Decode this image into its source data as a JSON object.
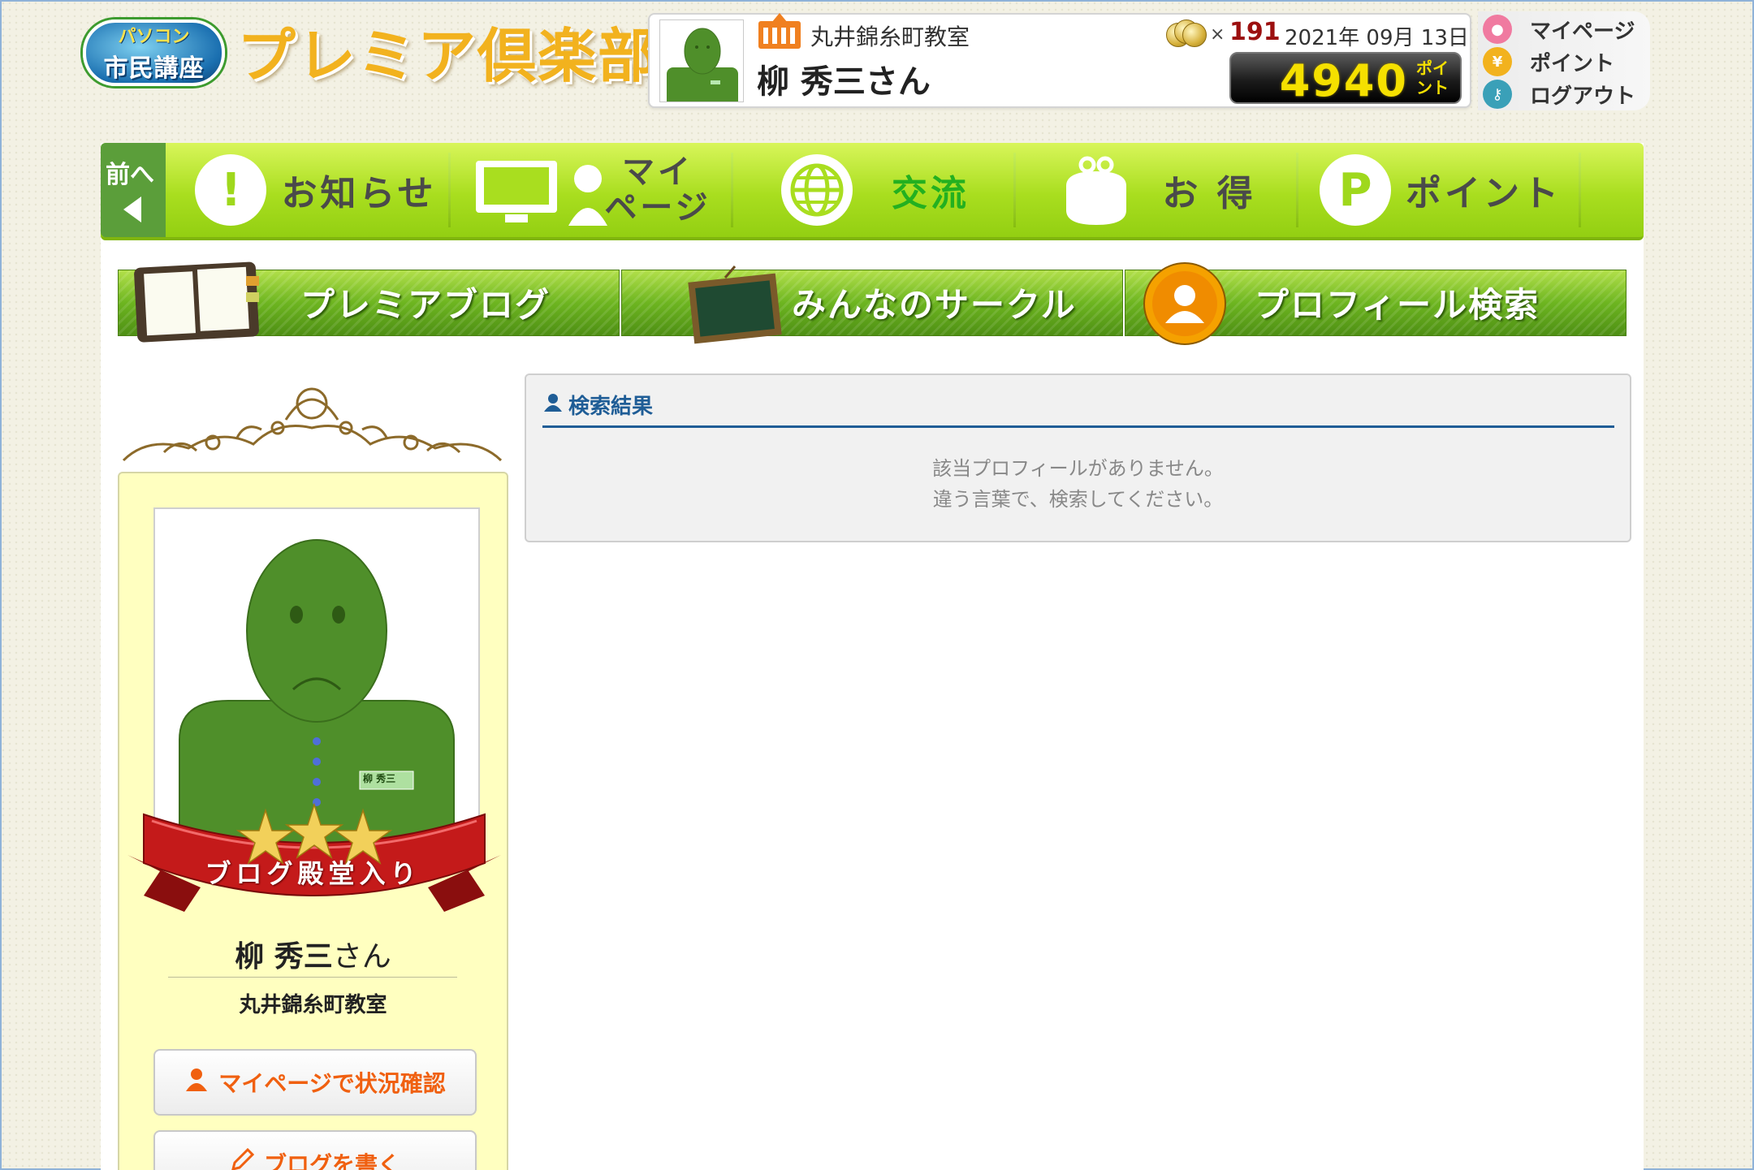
{
  "header": {
    "logo_line1": "パソコン",
    "logo_line2": "市民講座",
    "site_title": "プレミア倶楽部"
  },
  "user": {
    "school": "丸井錦糸町教室",
    "name": "柳 秀三さん",
    "coin_times": "×",
    "coin_count": "191",
    "date": "2021年 09月 13日",
    "points": "4940",
    "points_unit": "ポイント"
  },
  "quicklinks": [
    {
      "label": "マイページ",
      "icon": "person-icon",
      "color": "#f07aa0"
    },
    {
      "label": "ポイント",
      "icon": "coin-icon",
      "color": "#f2b21e"
    },
    {
      "label": "ログアウト",
      "icon": "key-icon",
      "color": "#3aa0b8"
    }
  ],
  "topnav": {
    "back_label": "前へ",
    "items": [
      {
        "label": "お知らせ",
        "icon": "exclamation-icon"
      },
      {
        "label": "マイ\nページ",
        "icon": "monitor-user-icon"
      },
      {
        "label": "交流",
        "icon": "globe-icon",
        "active": true
      },
      {
        "label": "お 得",
        "icon": "purse-icon"
      },
      {
        "label": "ポイント",
        "icon": "p-coin-icon"
      }
    ]
  },
  "subnav": [
    {
      "label": "プレミアブログ",
      "icon": "notebook-icon"
    },
    {
      "label": "みんなのサークル",
      "icon": "blackboard-icon"
    },
    {
      "label": "プロフィール検索",
      "icon": "profile-icon"
    }
  ],
  "profile": {
    "name": "柳 秀三",
    "suffix": "さん",
    "school": "丸井錦糸町教室",
    "nametag": "柳 秀三",
    "ribbon_text": "ブログ殿堂入り",
    "buttons": [
      {
        "label": "マイページで状況確認",
        "icon": "person-icon"
      },
      {
        "label": "ブログを書く",
        "icon": "pencil-icon"
      }
    ]
  },
  "results": {
    "title": "検索結果",
    "message_line1": "該当プロフィールがありません。",
    "message_line2": "違う言葉で、検索してください。"
  },
  "colors": {
    "nav_green": "#a9de1f",
    "active_green": "#23b020",
    "heading_blue": "#1f5d96",
    "button_orange": "#f06010"
  }
}
